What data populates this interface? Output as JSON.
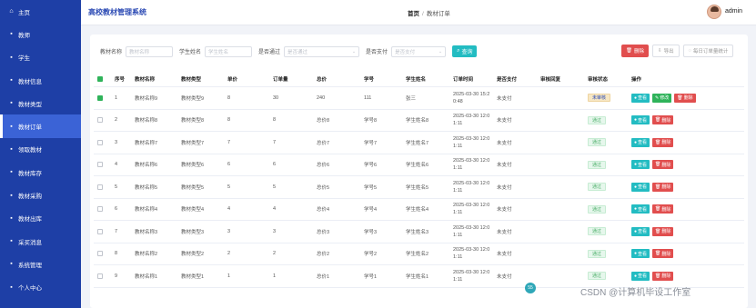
{
  "app": {
    "title": "高校教材管理系统"
  },
  "breadcrumb": {
    "home": "首页",
    "sep": "/",
    "current": "教材订单"
  },
  "user": {
    "name": "admin"
  },
  "sidebar": {
    "items": [
      {
        "label": "主页",
        "icon": "home-icon",
        "glyph": "⌂"
      },
      {
        "label": "教师",
        "icon": "grid-icon",
        "glyph": "▪"
      },
      {
        "label": "学生",
        "icon": "grid-icon",
        "glyph": "▪"
      },
      {
        "label": "教材信息",
        "icon": "grid-icon",
        "glyph": "▪"
      },
      {
        "label": "教材类型",
        "icon": "grid-icon",
        "glyph": "▪"
      },
      {
        "label": "教材订单",
        "icon": "grid-icon",
        "glyph": "▪"
      },
      {
        "label": "领取教材",
        "icon": "grid-icon",
        "glyph": "▪"
      },
      {
        "label": "教材库存",
        "icon": "grid-icon",
        "glyph": "▪"
      },
      {
        "label": "教材采购",
        "icon": "grid-icon",
        "glyph": "▪"
      },
      {
        "label": "教材出库",
        "icon": "grid-icon",
        "glyph": "▪"
      },
      {
        "label": "采买消息",
        "icon": "grid-icon",
        "glyph": "▪"
      },
      {
        "label": "系统管理",
        "icon": "grid-icon",
        "glyph": "▪"
      },
      {
        "label": "个人中心",
        "icon": "grid-icon",
        "glyph": "▪"
      }
    ],
    "active_index": 5
  },
  "filters": {
    "fields": [
      {
        "label": "教材名称",
        "placeholder": "教材名称",
        "type": "text"
      },
      {
        "label": "学生姓名",
        "placeholder": "学生姓名",
        "type": "text"
      },
      {
        "label": "是否通过",
        "placeholder": "是否通过",
        "type": "select"
      },
      {
        "label": "是否支付",
        "placeholder": "是否支付",
        "type": "select"
      }
    ],
    "search_label": "查询"
  },
  "actions": {
    "delete": "删除",
    "export": "导出",
    "stats": "每日订单量统计"
  },
  "table": {
    "headers": [
      "序号",
      "教材名称",
      "教材类型",
      "单价",
      "订单量",
      "总价",
      "学号",
      "学生姓名",
      "订单时间",
      "是否支付",
      "审核回复",
      "审核状态",
      "操作"
    ],
    "rows": [
      {
        "no": "1",
        "name": "教材名称9",
        "type": "教材类型9",
        "price": "8",
        "qty": "30",
        "total": "240",
        "sid": "111",
        "sname": "张三",
        "time1": "2025-03-30 15:2",
        "time2": "0:48",
        "paid": "未支付",
        "reply": "",
        "status": "未审核",
        "checked": true,
        "first": true
      },
      {
        "no": "2",
        "name": "教材名称8",
        "type": "教材类型8",
        "price": "8",
        "qty": "8",
        "total": "总价8",
        "sid": "学号8",
        "sname": "学生姓名8",
        "time1": "2025-03-30 12:0",
        "time2": "1:11",
        "paid": "未支付",
        "reply": "",
        "status": "通过",
        "checked": false,
        "first": false
      },
      {
        "no": "3",
        "name": "教材名称7",
        "type": "教材类型7",
        "price": "7",
        "qty": "7",
        "total": "总价7",
        "sid": "学号7",
        "sname": "学生姓名7",
        "time1": "2025-03-30 12:0",
        "time2": "1:11",
        "paid": "未支付",
        "reply": "",
        "status": "通过",
        "checked": false,
        "first": false
      },
      {
        "no": "4",
        "name": "教材名称6",
        "type": "教材类型6",
        "price": "6",
        "qty": "6",
        "total": "总价6",
        "sid": "学号6",
        "sname": "学生姓名6",
        "time1": "2025-03-30 12:0",
        "time2": "1:11",
        "paid": "未支付",
        "reply": "",
        "status": "通过",
        "checked": false,
        "first": false
      },
      {
        "no": "5",
        "name": "教材名称5",
        "type": "教材类型5",
        "price": "5",
        "qty": "5",
        "total": "总价5",
        "sid": "学号5",
        "sname": "学生姓名5",
        "time1": "2025-03-30 12:0",
        "time2": "1:11",
        "paid": "未支付",
        "reply": "",
        "status": "通过",
        "checked": false,
        "first": false
      },
      {
        "no": "6",
        "name": "教材名称4",
        "type": "教材类型4",
        "price": "4",
        "qty": "4",
        "total": "总价4",
        "sid": "学号4",
        "sname": "学生姓名4",
        "time1": "2025-03-30 12:0",
        "time2": "1:11",
        "paid": "未支付",
        "reply": "",
        "status": "通过",
        "checked": false,
        "first": false
      },
      {
        "no": "7",
        "name": "教材名称3",
        "type": "教材类型3",
        "price": "3",
        "qty": "3",
        "total": "总价3",
        "sid": "学号3",
        "sname": "学生姓名3",
        "time1": "2025-03-30 12:0",
        "time2": "1:11",
        "paid": "未支付",
        "reply": "",
        "status": "通过",
        "checked": false,
        "first": false
      },
      {
        "no": "8",
        "name": "教材名称2",
        "type": "教材类型2",
        "price": "2",
        "qty": "2",
        "total": "总价2",
        "sid": "学号2",
        "sname": "学生姓名2",
        "time1": "2025-03-30 12:0",
        "time2": "1:11",
        "paid": "未支付",
        "reply": "",
        "status": "通过",
        "checked": false,
        "first": false
      },
      {
        "no": "9",
        "name": "教材名称1",
        "type": "教材类型1",
        "price": "1",
        "qty": "1",
        "total": "总价1",
        "sid": "学号1",
        "sname": "学生姓名1",
        "time1": "2025-03-30 12:0",
        "time2": "1:11",
        "paid": "未支付",
        "reply": "",
        "status": "通过",
        "checked": false,
        "first": false
      }
    ],
    "op_labels": {
      "view": "查看",
      "edit": "修改",
      "delete": "删除"
    }
  },
  "watermark": "CSDN @计算机毕设工作室",
  "colors": {
    "sidebar": "#1e3fa6",
    "accent": "#23bcc2",
    "danger": "#e14e4e",
    "success": "#2fb35a"
  }
}
